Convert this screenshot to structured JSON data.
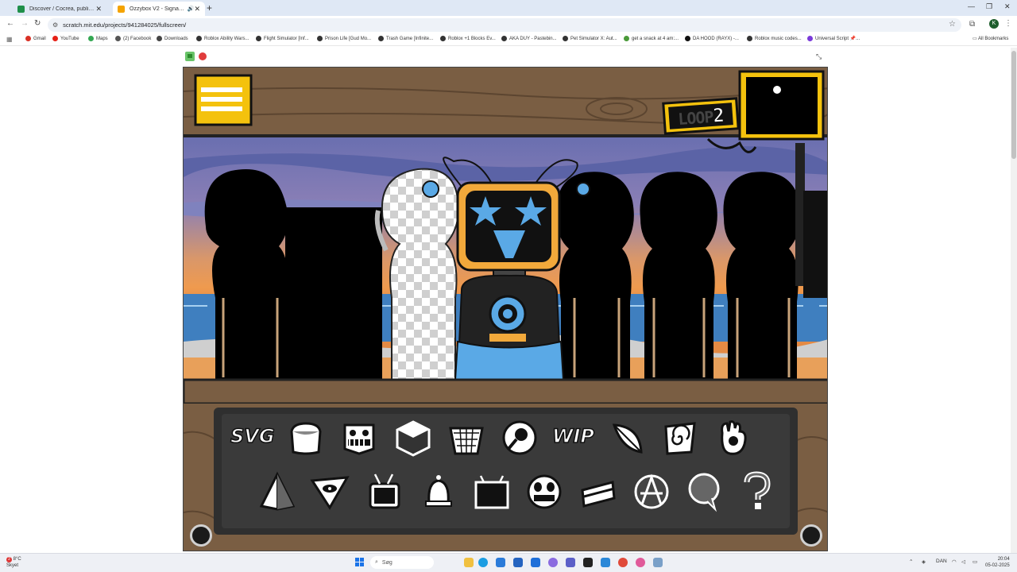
{
  "browser": {
    "tabs": [
      {
        "title": "Discover / Cocrea, publish a Sc",
        "active": false,
        "favicon_color": "#1f8f4a"
      },
      {
        "title": "Ozzybox V2 - Signal on Sc",
        "active": true,
        "favicon_color": "#f4a300"
      }
    ],
    "url": "scratch.mit.edu/projects/941284025/fullscreen/",
    "bookmarks": [
      {
        "label": "Gmail",
        "icon": "gmail-icon"
      },
      {
        "label": "YouTube",
        "icon": "youtube-icon"
      },
      {
        "label": "Maps",
        "icon": "maps-icon"
      },
      {
        "label": "(2) Facebook",
        "icon": "facebook-icon"
      },
      {
        "label": "Downloads",
        "icon": "download-icon"
      },
      {
        "label": "Roblox Ability Wars...",
        "icon": "roblox-icon"
      },
      {
        "label": "Flight Simulator [Inf...",
        "icon": "roblox-icon"
      },
      {
        "label": "Prison Life [Gud Mo...",
        "icon": "roblox-icon"
      },
      {
        "label": "Trash Game [Infinite...",
        "icon": "roblox-icon"
      },
      {
        "label": "Roblox +1 Blocks Ev...",
        "icon": "roblox-icon"
      },
      {
        "label": "AKA DUY - Pastebin...",
        "icon": "roblox-icon"
      },
      {
        "label": "Pet Simulator X: Aut...",
        "icon": "roblox-icon"
      },
      {
        "label": "get a snack at 4 am:...",
        "icon": "leaf-icon"
      },
      {
        "label": "DA HOOD (RAYX) -...",
        "icon": "square-icon"
      },
      {
        "label": "Roblox music codes...",
        "icon": "roblox-icon"
      },
      {
        "label": "Universal Script 📌...",
        "icon": "script-icon"
      }
    ],
    "all_bookmarks": "All Bookmarks",
    "profile_initial": "K"
  },
  "game": {
    "loop_prefix": "LOOP",
    "loop_number": "2",
    "buttons_row1": [
      "svg",
      "loaf",
      "grin-face",
      "cube",
      "basket",
      "microphone",
      "wip",
      "feather",
      "swirl-card",
      "glove"
    ],
    "buttons_row2": [
      "pyramid",
      "eye-triangle",
      "tv",
      "bell",
      "tv-box",
      "mask-face",
      "cake-slice",
      "anarchy",
      "speech-bubble",
      "question-mark"
    ],
    "svg_label": "SVG",
    "wip_label": "WIP",
    "selected_character": "star-eyed-robot"
  },
  "taskbar": {
    "weather_temp": "8°C",
    "weather_desc": "Skyet",
    "weather_badge": "2",
    "search_placeholder": "Søg",
    "language": "DAN",
    "time": "20:04",
    "date": "05-02-2025"
  },
  "colors": {
    "wood": "#7a5e43",
    "wood_dark": "#5c4530",
    "panel": "#3a3a3a",
    "accent_blue": "#5aa9e6",
    "accent_orange": "#f2a93b",
    "gold": "#f4c20d"
  }
}
